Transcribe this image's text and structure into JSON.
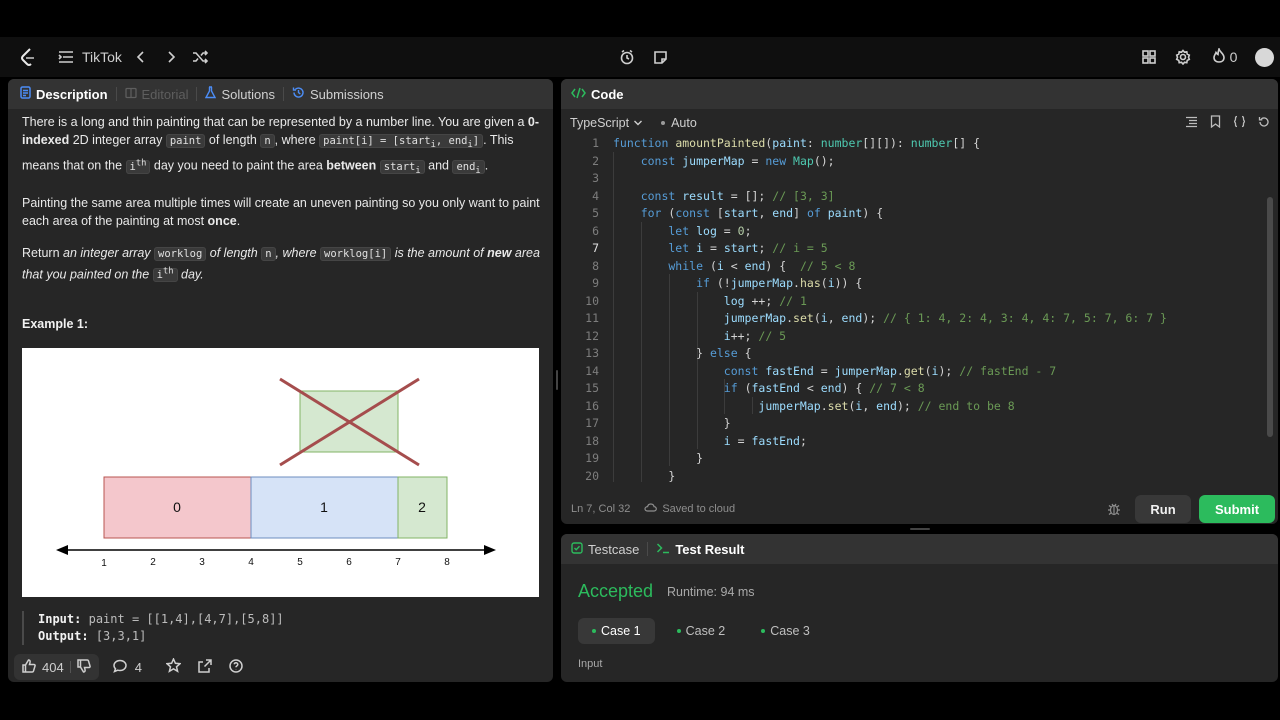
{
  "topbar": {
    "problem_list_label": "TikTok",
    "points": "0",
    "icons": [
      "logo-icon",
      "list-icon",
      "prev-icon",
      "next-icon",
      "shuffle-icon",
      "timer-icon",
      "note-icon",
      "grid-icon",
      "settings-icon",
      "fire-icon",
      "avatar"
    ]
  },
  "left_panel": {
    "tabs": [
      {
        "label": "Description"
      },
      {
        "label": "Editorial"
      },
      {
        "label": "Solutions"
      },
      {
        "label": "Submissions"
      }
    ],
    "description": {
      "p1": {
        "t1": "There is a long and thin painting that can be represented by a number line. You are given a ",
        "b1": "0-indexed",
        "t2": " 2D integer array ",
        "c1": "paint",
        "t3": " of length ",
        "c2": "n",
        "t4": ", where ",
        "c3": "paint[i] = [start",
        "c3sub": "i",
        "c3b": ", end",
        "c3sub2": "i",
        "c3c": "]",
        "t5": ". This means that on the ",
        "c4": "i",
        "c4sup": "th",
        "t6": " day you need to paint the area ",
        "b2": "between",
        "t7": " ",
        "c5": "start",
        "c5sub": "i",
        "t8": " and ",
        "c6": "end",
        "c6sub": "i",
        "t9": "."
      },
      "p2": {
        "t1": "Painting the same area multiple times will create an uneven painting so you only want to paint each area of the painting at most ",
        "b1": "once",
        "t2": "."
      },
      "p3": {
        "t1": "Return ",
        "i1": "an integer array ",
        "c1": "worklog",
        "i2": " of length ",
        "c2": "n",
        "i3": ", where ",
        "c3": "worklog[i]",
        "i4": " is the amount of ",
        "b1": "new",
        "i5": " area that you painted on the ",
        "c4": "i",
        "c4sup": "th",
        "i6": " day."
      }
    },
    "example_title": "Example 1:",
    "diagram": {
      "segments": [
        "0",
        "1",
        "2"
      ],
      "ticks": [
        "1",
        "2",
        "3",
        "4",
        "5",
        "6",
        "7",
        "8"
      ],
      "colors": {
        "seg0": "#f4c7cc",
        "seg1": "#d6e3f7",
        "seg2": "#d5e8d0",
        "cross": "#a54d4d"
      }
    },
    "example": {
      "input_label": "Input:",
      "input_value": "paint = [[1,4],[4,7],[5,8]]",
      "output_label": "Output:",
      "output_value": "[3,3,1]"
    },
    "footer": {
      "likes": "404",
      "comments": "4"
    }
  },
  "code_panel": {
    "title": "Code",
    "language": "TypeScript",
    "mode": "Auto",
    "line_numbers": [
      "1",
      "2",
      "3",
      "4",
      "5",
      "6",
      "7",
      "8",
      "9",
      "10",
      "11",
      "12",
      "13",
      "14",
      "15",
      "16",
      "17",
      "18",
      "19",
      "20"
    ],
    "current_line": 7,
    "status": {
      "cursor": "Ln 7, Col 32",
      "saved": "Saved to cloud"
    },
    "run_label": "Run",
    "submit_label": "Submit"
  },
  "result_panel": {
    "tabs": [
      {
        "label": "Testcase"
      },
      {
        "label": "Test Result"
      }
    ],
    "verdict": "Accepted",
    "runtime": "Runtime: 94 ms",
    "cases": [
      "Case 1",
      "Case 2",
      "Case 3"
    ],
    "input_label": "Input"
  },
  "colors": {
    "accent_green": "#2cbb5d",
    "panel_bg": "#262626",
    "header_bg": "#333333"
  }
}
